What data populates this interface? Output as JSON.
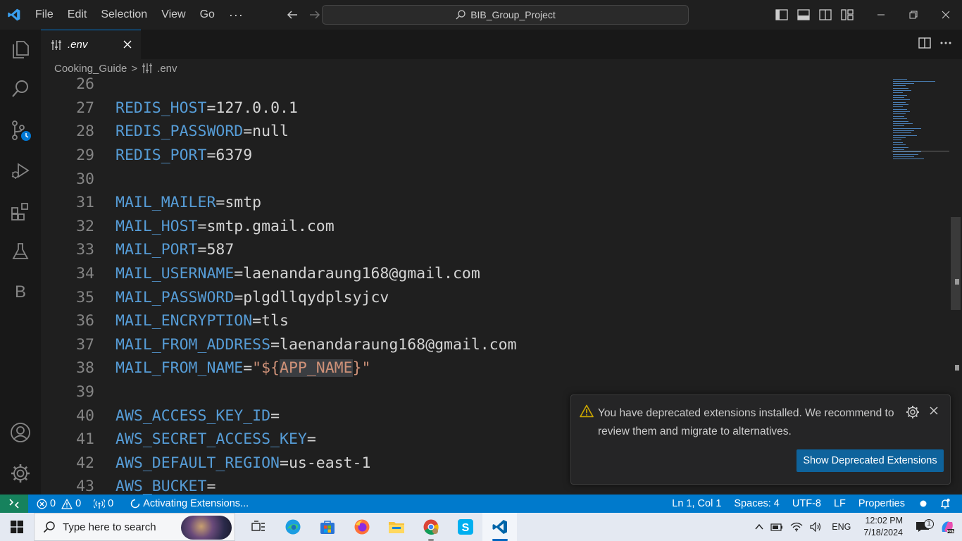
{
  "window": {
    "title": "BIB_Group_Project"
  },
  "menu": [
    "File",
    "Edit",
    "Selection",
    "View",
    "Go"
  ],
  "menu_more": "···",
  "tab": {
    "label": ".env"
  },
  "breadcrumb": {
    "folder": "Cooking_Guide",
    "separator": ">",
    "file": ".env"
  },
  "activity_bar": {
    "accounts_letter": "B"
  },
  "editor": {
    "lines": [
      {
        "num": "26",
        "key": "",
        "eq": "",
        "val": ""
      },
      {
        "num": "27",
        "key": "REDIS_HOST",
        "eq": "=",
        "val": "127.0.0.1"
      },
      {
        "num": "28",
        "key": "REDIS_PASSWORD",
        "eq": "=",
        "val": "null"
      },
      {
        "num": "29",
        "key": "REDIS_PORT",
        "eq": "=",
        "val": "6379"
      },
      {
        "num": "30",
        "key": "",
        "eq": "",
        "val": ""
      },
      {
        "num": "31",
        "key": "MAIL_MAILER",
        "eq": "=",
        "val": "smtp"
      },
      {
        "num": "32",
        "key": "MAIL_HOST",
        "eq": "=",
        "val": "smtp.gmail.com"
      },
      {
        "num": "33",
        "key": "MAIL_PORT",
        "eq": "=",
        "val": "587"
      },
      {
        "num": "34",
        "key": "MAIL_USERNAME",
        "eq": "=",
        "val": "laenandaraung168@gmail.com"
      },
      {
        "num": "35",
        "key": "MAIL_PASSWORD",
        "eq": "=",
        "val": "plgdllqydplsyjcv"
      },
      {
        "num": "36",
        "key": "MAIL_ENCRYPTION",
        "eq": "=",
        "val": "tls"
      },
      {
        "num": "37",
        "key": "MAIL_FROM_ADDRESS",
        "eq": "=",
        "val": "laenandaraung168@gmail.com"
      },
      {
        "num": "38",
        "key": "MAIL_FROM_NAME",
        "eq": "=",
        "str_open": "\"${",
        "str_var": "APP_NAME",
        "str_close": "}\""
      },
      {
        "num": "39",
        "key": "",
        "eq": "",
        "val": ""
      },
      {
        "num": "40",
        "key": "AWS_ACCESS_KEY_ID",
        "eq": "=",
        "val": ""
      },
      {
        "num": "41",
        "key": "AWS_SECRET_ACCESS_KEY",
        "eq": "=",
        "val": ""
      },
      {
        "num": "42",
        "key": "AWS_DEFAULT_REGION",
        "eq": "=",
        "val": "us-east-1"
      },
      {
        "num": "43",
        "key": "AWS_BUCKET",
        "eq": "=",
        "val": ""
      }
    ]
  },
  "notification": {
    "message": "You have deprecated extensions installed. We recommend to review them and migrate to alternatives.",
    "button": "Show Deprecated Extensions"
  },
  "statusbar": {
    "errors": "0",
    "warnings": "0",
    "ports": "0",
    "activity": "Activating Extensions...",
    "cursor": "Ln 1, Col 1",
    "spaces": "Spaces: 4",
    "encoding": "UTF-8",
    "eol": "LF",
    "language": "Properties"
  },
  "taskbar": {
    "search_placeholder": "Type here to search",
    "language": "ENG",
    "time": "12:02 PM",
    "date": "7/18/2024",
    "notification_count": "1"
  },
  "colors": {
    "accent": "#007acc",
    "key": "#569cd6",
    "string": "#ce9178",
    "button": "#0e639c"
  }
}
